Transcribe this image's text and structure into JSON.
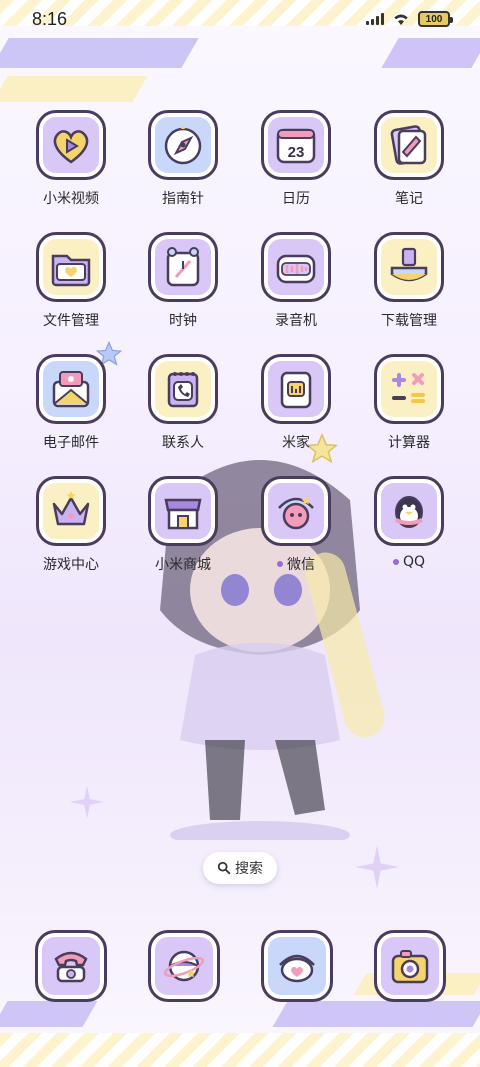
{
  "status_bar": {
    "time": "8:16",
    "battery": "100"
  },
  "apps": [
    {
      "label": "小米视频",
      "icon": "video-heart-icon",
      "bg": "purple"
    },
    {
      "label": "指南针",
      "icon": "compass-icon",
      "bg": "blue"
    },
    {
      "label": "日历",
      "icon": "calendar-icon",
      "bg": "purple",
      "calendar_day": "23"
    },
    {
      "label": "笔记",
      "icon": "notes-icon",
      "bg": "yellow"
    },
    {
      "label": "文件管理",
      "icon": "folder-icon",
      "bg": "yellow"
    },
    {
      "label": "时钟",
      "icon": "clock-icon",
      "bg": "purple"
    },
    {
      "label": "录音机",
      "icon": "recorder-icon",
      "bg": "purple"
    },
    {
      "label": "下载管理",
      "icon": "download-icon",
      "bg": "yellow"
    },
    {
      "label": "电子邮件",
      "icon": "mail-icon",
      "bg": "blue"
    },
    {
      "label": "联系人",
      "icon": "contacts-icon",
      "bg": "yellow"
    },
    {
      "label": "米家",
      "icon": "mihome-icon",
      "bg": "purple"
    },
    {
      "label": "计算器",
      "icon": "calculator-icon",
      "bg": "yellow"
    },
    {
      "label": "游戏中心",
      "icon": "crown-icon",
      "bg": "yellow"
    },
    {
      "label": "小米商城",
      "icon": "store-icon",
      "bg": "purple"
    },
    {
      "label": "微信",
      "icon": "wechat-icon",
      "bg": "purple",
      "dot": true
    },
    {
      "label": "QQ",
      "icon": "qq-penguin-icon",
      "bg": "purple",
      "dot": true
    }
  ],
  "search": {
    "label": "搜索"
  },
  "dock": [
    {
      "icon": "phone-icon",
      "bg": "purple"
    },
    {
      "icon": "planet-icon",
      "bg": "purple"
    },
    {
      "icon": "messages-icon",
      "bg": "blue"
    },
    {
      "icon": "camera-icon",
      "bg": "purple"
    }
  ]
}
